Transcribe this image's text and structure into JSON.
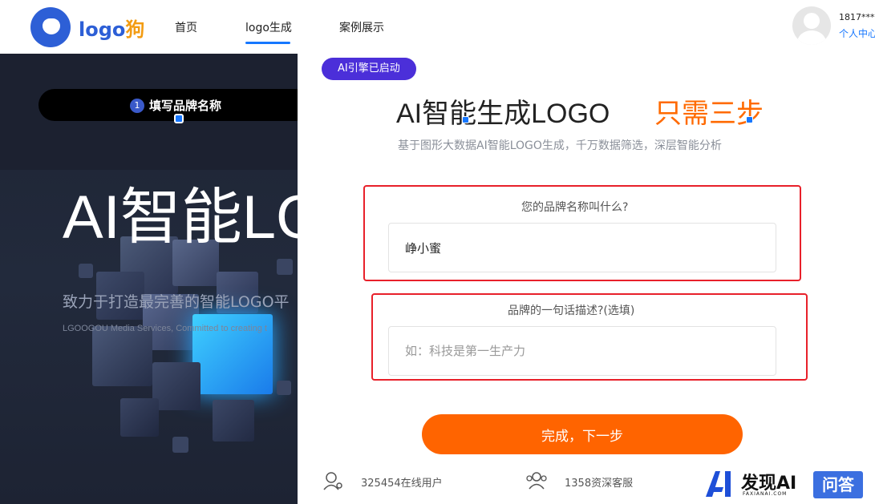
{
  "header": {
    "logo_text_a": "logo",
    "logo_text_b": "狗",
    "nav": [
      "首页",
      "logo生成",
      "案例展示"
    ],
    "user_phone": "1817****",
    "user_center": "个人中心"
  },
  "hero": {
    "step_number": "1",
    "step_label": "填写品牌名称",
    "title": "AI智能LO",
    "subtitle": "致力于打造最完善的智能LOGO平",
    "english": "LGOOGOU Media Services, Committed to creating t"
  },
  "card": {
    "badge": "AI引擎已启动",
    "title": "AI智能生成LOGO",
    "title_accent": "只需三步",
    "description": "基于图形大数据AI智能LOGO生成，千万数据筛选，深层智能分析",
    "brand_question": "您的品牌名称叫什么?",
    "brand_value": "峥小蜜",
    "slogan_question": "品牌的一句话描述?(选填)",
    "slogan_placeholder": "如：科技是第一生产力",
    "next_button": "完成，下一步",
    "stats": [
      {
        "icon": "user-icon",
        "text": "325454在线用户"
      },
      {
        "icon": "users-icon",
        "text": "1358资深客服"
      }
    ]
  },
  "watermark": {
    "brand": "发现AI",
    "domain": "FAXIANAI.COM",
    "action": "问答"
  },
  "colors": {
    "accent_orange": "#ff6400",
    "badge_purple": "#4b2fd9",
    "link_blue": "#1677ff",
    "highlight_red": "#e8202a"
  }
}
